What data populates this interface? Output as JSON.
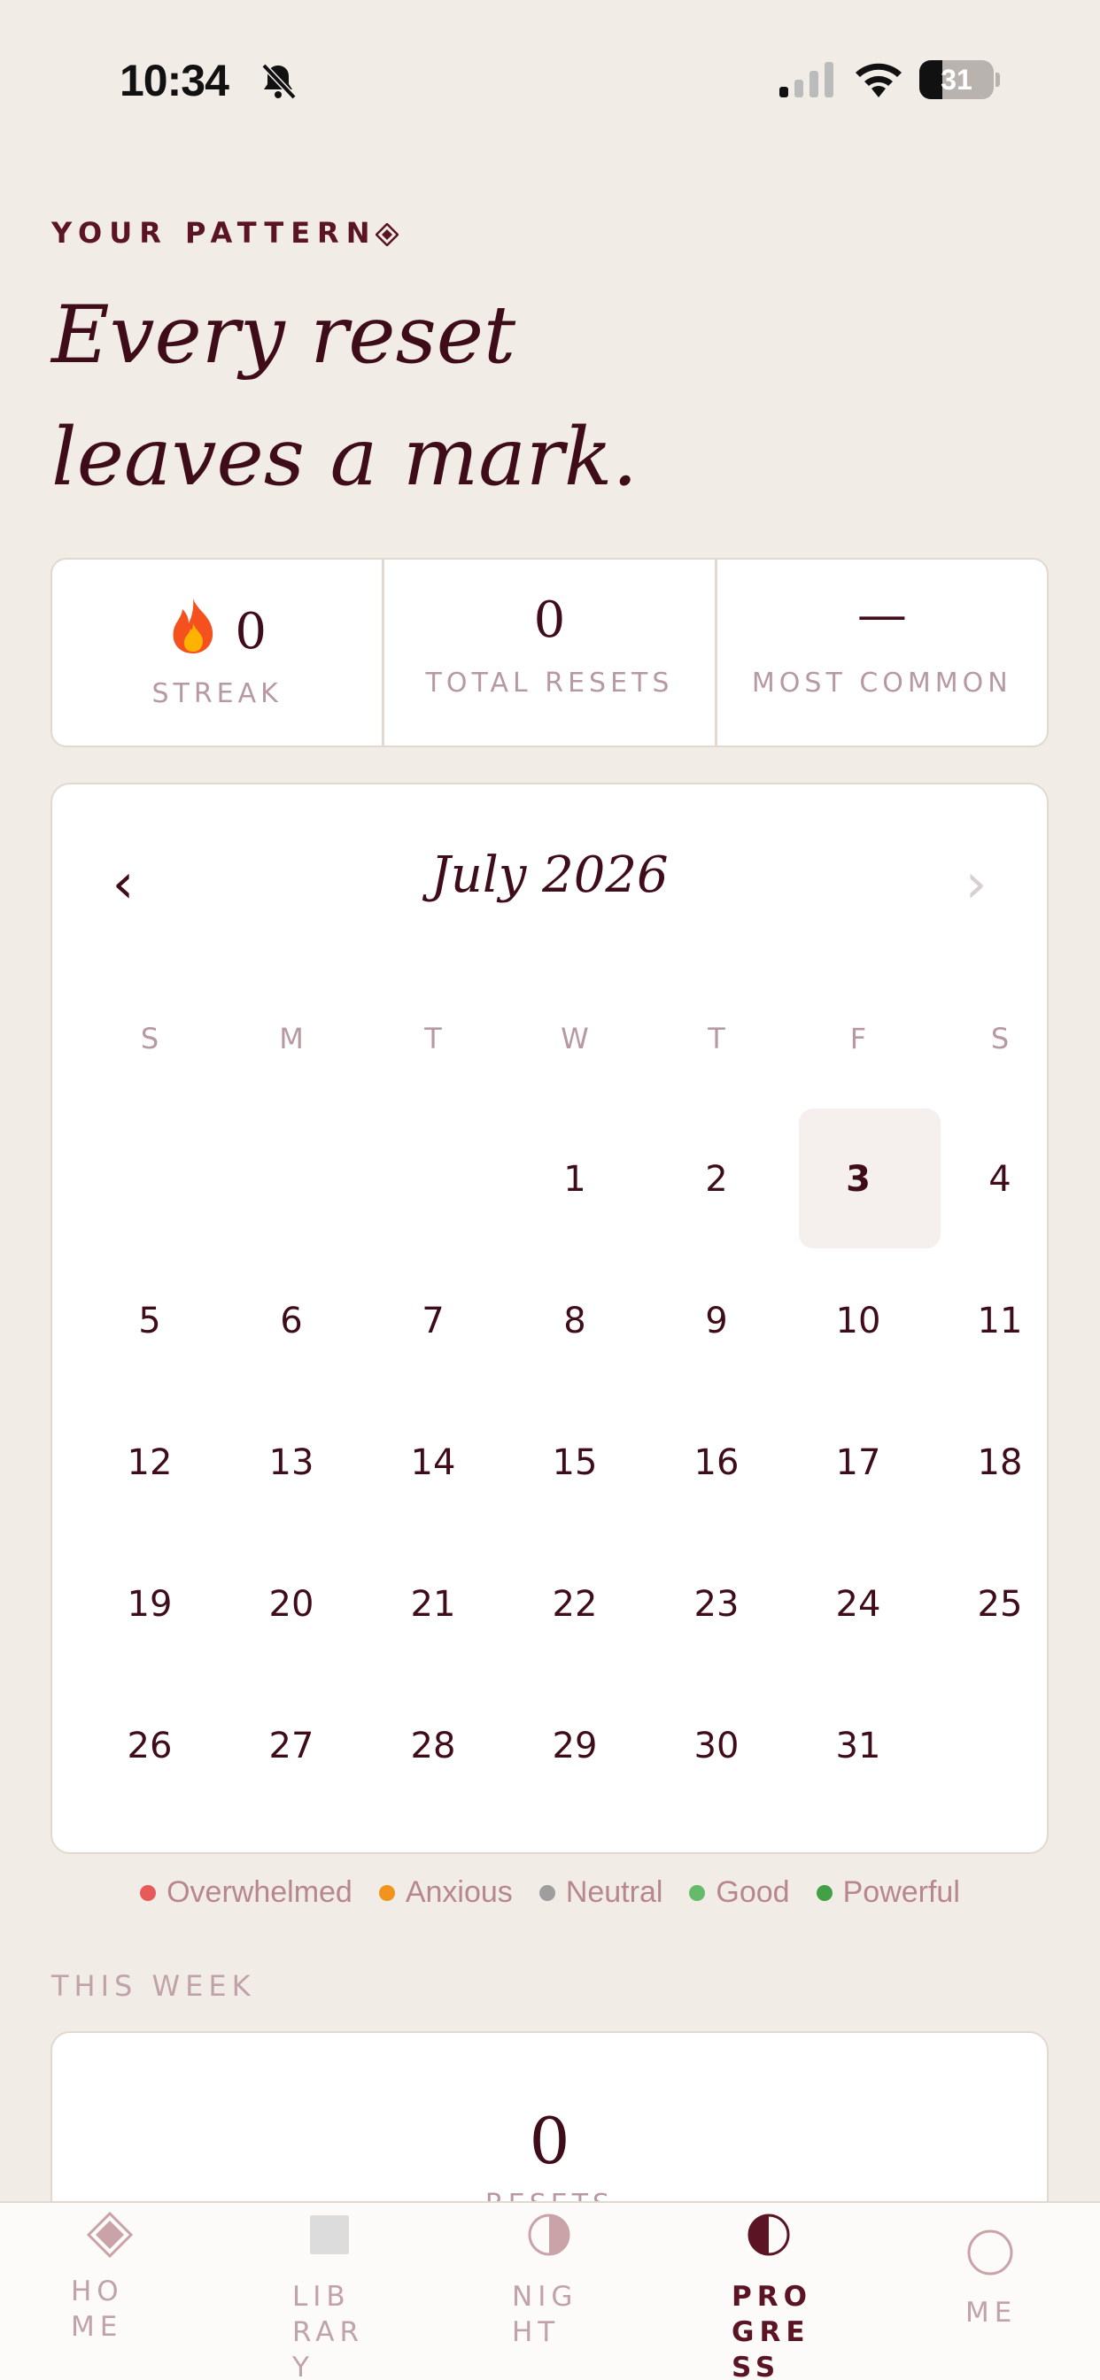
{
  "status_bar": {
    "time": "10:34",
    "battery": "31",
    "battery_level": 0.31
  },
  "header": {
    "eyebrow": "YOUR PATTERN",
    "headline_line1": "Every reset",
    "headline_line2": "leaves a mark."
  },
  "stats": [
    {
      "value": "0",
      "label": "STREAK",
      "icon": "flame-icon"
    },
    {
      "value": "0",
      "label": "TOTAL RESETS"
    },
    {
      "value": "—",
      "label": "MOST COMMON"
    }
  ],
  "calendar": {
    "title": "July 2026",
    "prev": "‹",
    "next": "›",
    "weekdays": [
      "S",
      "M",
      "T",
      "W",
      "T",
      "F",
      "S"
    ],
    "weeks": [
      [
        "",
        "",
        "",
        "1",
        "2",
        "3",
        "4"
      ],
      [
        "5",
        "6",
        "7",
        "8",
        "9",
        "10",
        "11"
      ],
      [
        "12",
        "13",
        "14",
        "15",
        "16",
        "17",
        "18"
      ],
      [
        "19",
        "20",
        "21",
        "22",
        "23",
        "24",
        "25"
      ],
      [
        "26",
        "27",
        "28",
        "29",
        "30",
        "31",
        ""
      ]
    ],
    "today": "3"
  },
  "legend": [
    {
      "label": "Overwhelmed",
      "color": "#e85a5a"
    },
    {
      "label": "Anxious",
      "color": "#f0941e"
    },
    {
      "label": "Neutral",
      "color": "#9e9e9e"
    },
    {
      "label": "Good",
      "color": "#66bb6a"
    },
    {
      "label": "Powerful",
      "color": "#43a047"
    }
  ],
  "this_week": {
    "section_label": "THIS WEEK",
    "value": "0",
    "label": "RESETS"
  },
  "tabbar": {
    "tabs": [
      {
        "label_lines": [
          "HO",
          "ME"
        ],
        "icon": "diamond-icon",
        "active": false
      },
      {
        "label_lines": [
          "LIB",
          "RAR",
          "Y"
        ],
        "icon": "square-icon",
        "active": false
      },
      {
        "label_lines": [
          "NIG",
          "HT"
        ],
        "icon": "half-moon-icon",
        "active": false
      },
      {
        "label_lines": [
          "PRO",
          "GRE",
          "SS"
        ],
        "icon": "half-circle-icon",
        "active": true
      },
      {
        "label_lines": [
          "ME"
        ],
        "icon": "circle-icon",
        "active": false
      }
    ]
  },
  "colors": {
    "background": "#f2ece7",
    "accent": "#5a1424",
    "muted": "#b79aa1"
  }
}
